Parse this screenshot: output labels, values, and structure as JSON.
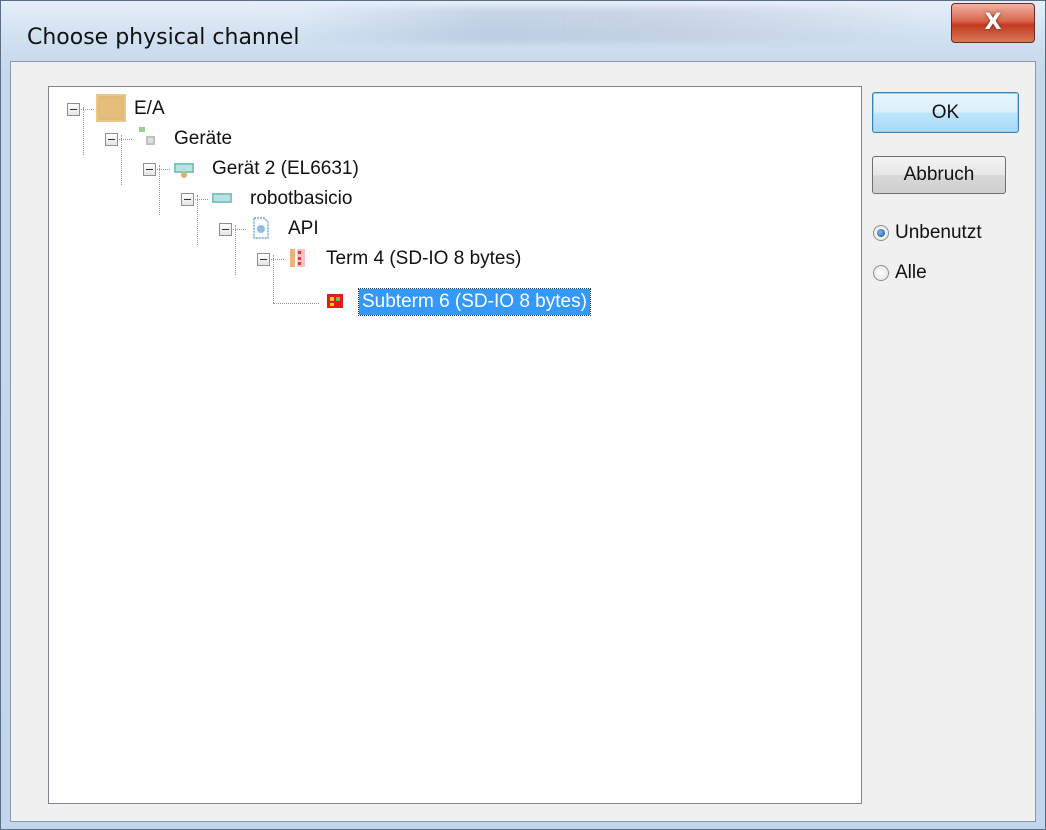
{
  "window": {
    "title": "Choose physical channel",
    "close_glyph": "X"
  },
  "tree": {
    "nodes": [
      {
        "label": "E/A",
        "icon": "io-root-icon"
      },
      {
        "label": "Geräte",
        "icon": "devices-icon"
      },
      {
        "label": "Gerät 2 (EL6631)",
        "icon": "device-icon"
      },
      {
        "label": "robotbasicio",
        "icon": "box-icon"
      },
      {
        "label": "API",
        "icon": "api-icon"
      },
      {
        "label": "Term 4 (SD-IO 8 bytes)",
        "icon": "terminal-icon"
      },
      {
        "label": "Subterm 6 (SD-IO 8 bytes)",
        "icon": "subterminal-icon"
      }
    ],
    "selected_index": 6
  },
  "buttons": {
    "ok": "OK",
    "cancel": "Abbruch"
  },
  "filter": {
    "options": [
      {
        "label": "Unbenutzt",
        "checked": true
      },
      {
        "label": "Alle",
        "checked": false
      }
    ]
  }
}
